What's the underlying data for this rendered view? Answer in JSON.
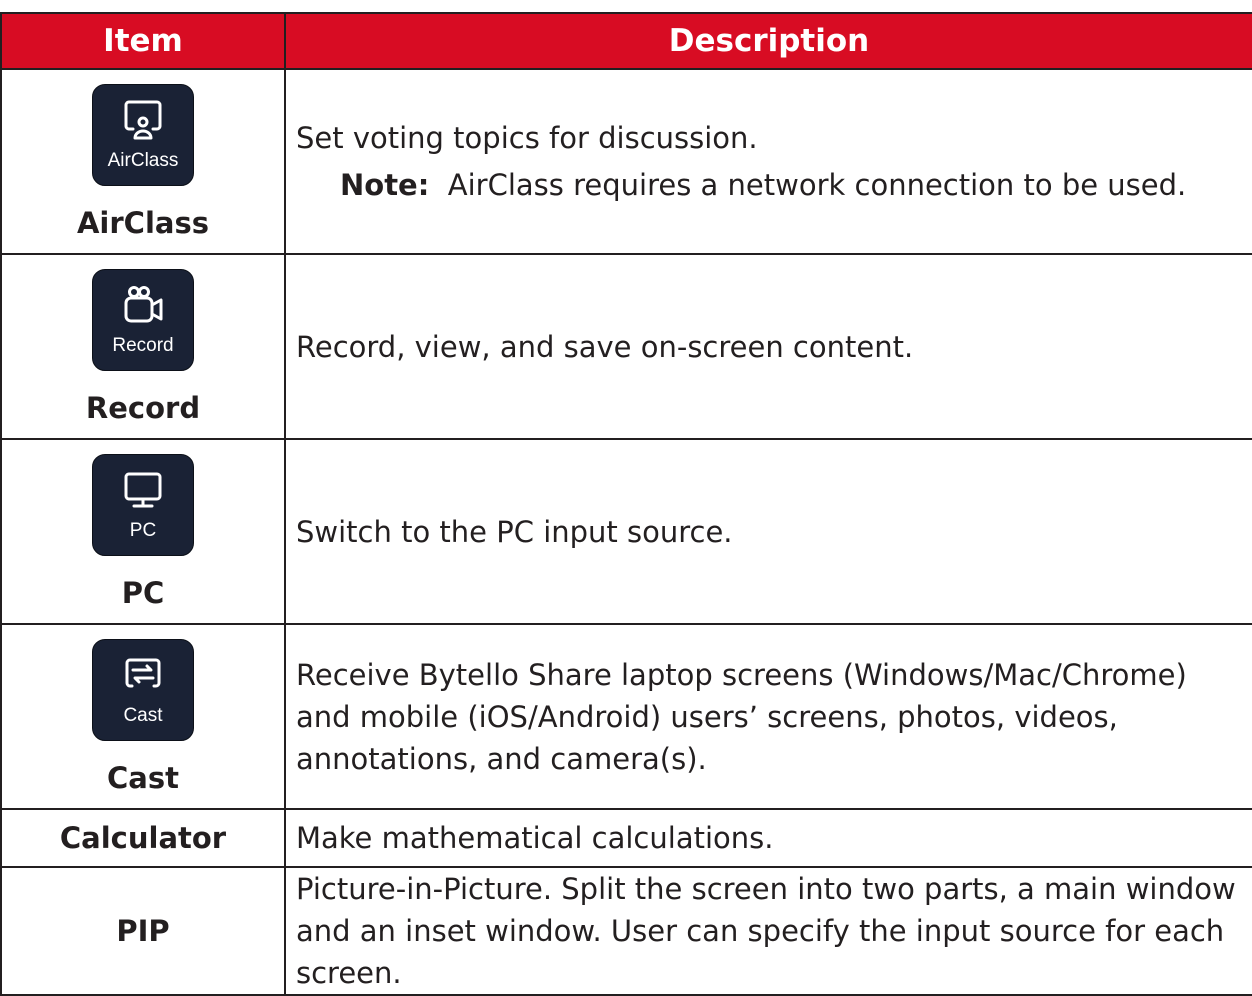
{
  "header": {
    "item": "Item",
    "description": "Description"
  },
  "rows": [
    {
      "name": "AirClass",
      "tile_label": "AirClass",
      "icon": "presenter-screen-icon",
      "description": "Set voting topics for discussion.",
      "note_label": "Note:",
      "note_text": "AirClass requires a network connection to be used."
    },
    {
      "name": "Record",
      "tile_label": "Record",
      "icon": "video-camera-icon",
      "description": "Record, view, and save on-screen content."
    },
    {
      "name": "PC",
      "tile_label": "PC",
      "icon": "monitor-icon",
      "description": "Switch to the PC input source."
    },
    {
      "name": "Cast",
      "tile_label": "Cast",
      "icon": "cast-arrows-icon",
      "description": "Receive Bytello Share laptop screens (Windows/Mac/Chrome) and mobile (iOS/Android) users’ screens, photos, videos, annotations, and camera(s)."
    },
    {
      "name": "Calculator",
      "description": "Make mathematical calculations."
    },
    {
      "name": "PIP",
      "description": "Picture-in-Picture. Split the screen into two parts, a main window and an inset window. User can specify the input source for each screen."
    }
  ],
  "colors": {
    "header_bg": "#d80c23",
    "header_text": "#ffffff",
    "tile_bg": "#1a2235",
    "border": "#231f20"
  }
}
